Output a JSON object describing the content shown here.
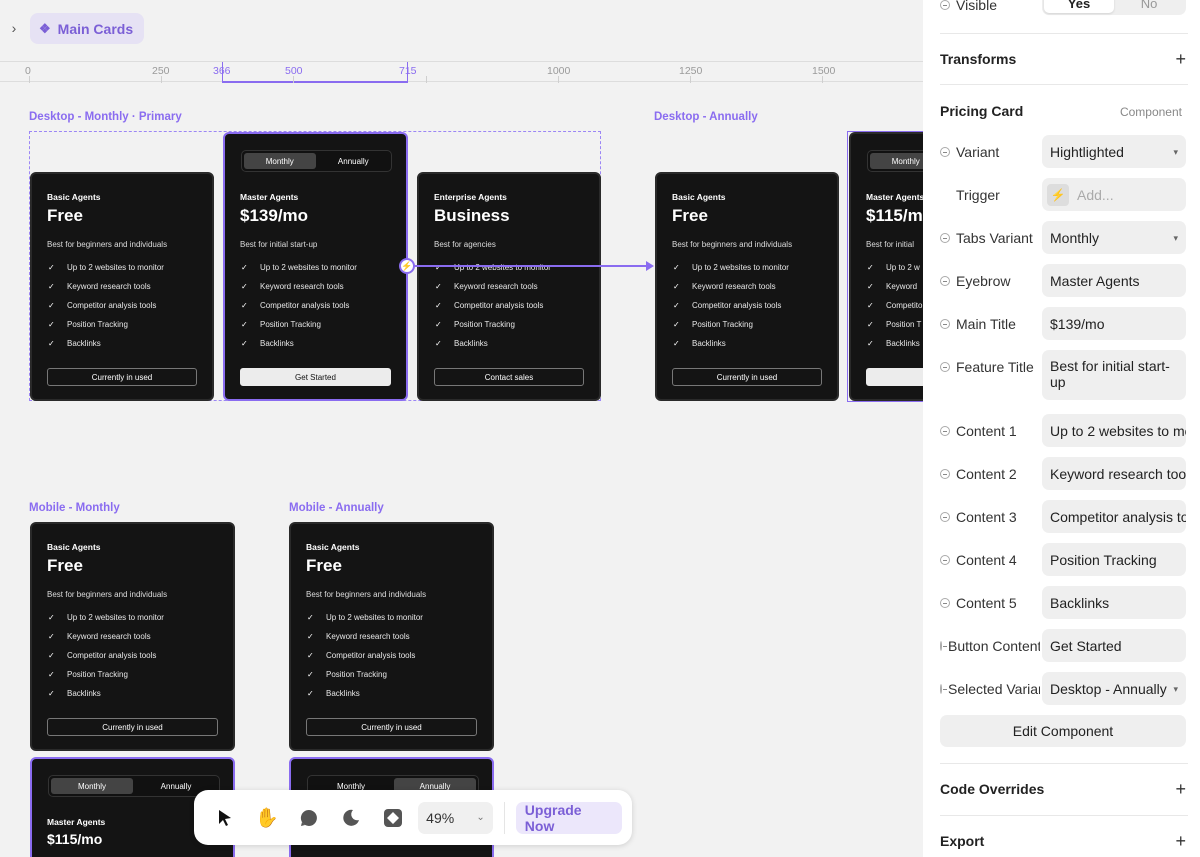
{
  "breadcrumb": {
    "label": "Main Cards"
  },
  "ruler": {
    "ticks": [
      "0",
      "250",
      "366",
      "500",
      "715",
      "1000",
      "1250",
      "1500"
    ]
  },
  "frames": {
    "desktop_monthly": "Desktop - Monthly · Primary",
    "desktop_annually": "Desktop - Annually",
    "mobile_monthly": "Mobile - Monthly",
    "mobile_annually": "Mobile - Annually"
  },
  "tabs": {
    "monthly": "Monthly",
    "annually": "Annually"
  },
  "features": [
    "Up to 2 websites to monitor",
    "Keyword research tools",
    "Competitor analysis tools",
    "Position Tracking",
    "Backlinks"
  ],
  "cards": {
    "basic": {
      "eyebrow": "Basic Agents",
      "title": "Free",
      "desc": "Best for beginners and individuals",
      "button": "Currently in used"
    },
    "master": {
      "eyebrow": "Master Agents",
      "title": "$139/mo",
      "desc": "Best for initial start-up",
      "button": "Get Started"
    },
    "enterprise": {
      "eyebrow": "Enterprise Agents",
      "title": "Business",
      "desc": "Best for agencies",
      "button": "Contact sales"
    },
    "master_annual": {
      "eyebrow": "Master Agents",
      "title": "$115/mo",
      "desc": "Best for initial start-up",
      "button": "Get Started"
    }
  },
  "cut": {
    "master_ann_eyebrow": "Master Agents",
    "master_ann_title": "$115/m",
    "master_ann_desc": "Best for initial",
    "f1": "Up to 2 w",
    "f2": "Keyword",
    "f3": "Competito",
    "f4": "Position T",
    "f5": "Backlinks",
    "btn": "G"
  },
  "toolbar": {
    "zoom": "49%",
    "upgrade": "Upgrade Now"
  },
  "panel": {
    "visible_label": "Visible",
    "visible_yes": "Yes",
    "visible_no": "No",
    "transforms": "Transforms",
    "component_name": "Pricing Card",
    "component_tag": "Component",
    "rows": [
      {
        "label": "Variant",
        "value": "Hightlighted"
      },
      {
        "label": "Trigger",
        "value": "Add..."
      },
      {
        "label": "Tabs Variant",
        "value": "Monthly"
      },
      {
        "label": "Eyebrow",
        "value": "Master Agents"
      },
      {
        "label": "Main Title",
        "value": "$139/mo"
      },
      {
        "label": "Feature Title",
        "value": "Best for initial start-up"
      },
      {
        "label": "Content 1",
        "value": "Up to 2 websites to monitor"
      },
      {
        "label": "Content 2",
        "value": "Keyword research tools"
      },
      {
        "label": "Content 3",
        "value": "Competitor analysis tools"
      },
      {
        "label": "Content 4",
        "value": "Position Tracking"
      },
      {
        "label": "Content 5",
        "value": "Backlinks"
      },
      {
        "label": "Button Content",
        "value": "Get Started"
      },
      {
        "label": "Selected Variant",
        "value": "Desktop - Annually"
      }
    ],
    "edit_component": "Edit Component",
    "code_overrides": "Code Overrides",
    "export": "Export"
  },
  "icons": {
    "breadcrumb": "component-icon",
    "toolbar": [
      "cursor-icon",
      "hand-icon",
      "comment-icon",
      "theme-icon",
      "components-icon"
    ]
  }
}
